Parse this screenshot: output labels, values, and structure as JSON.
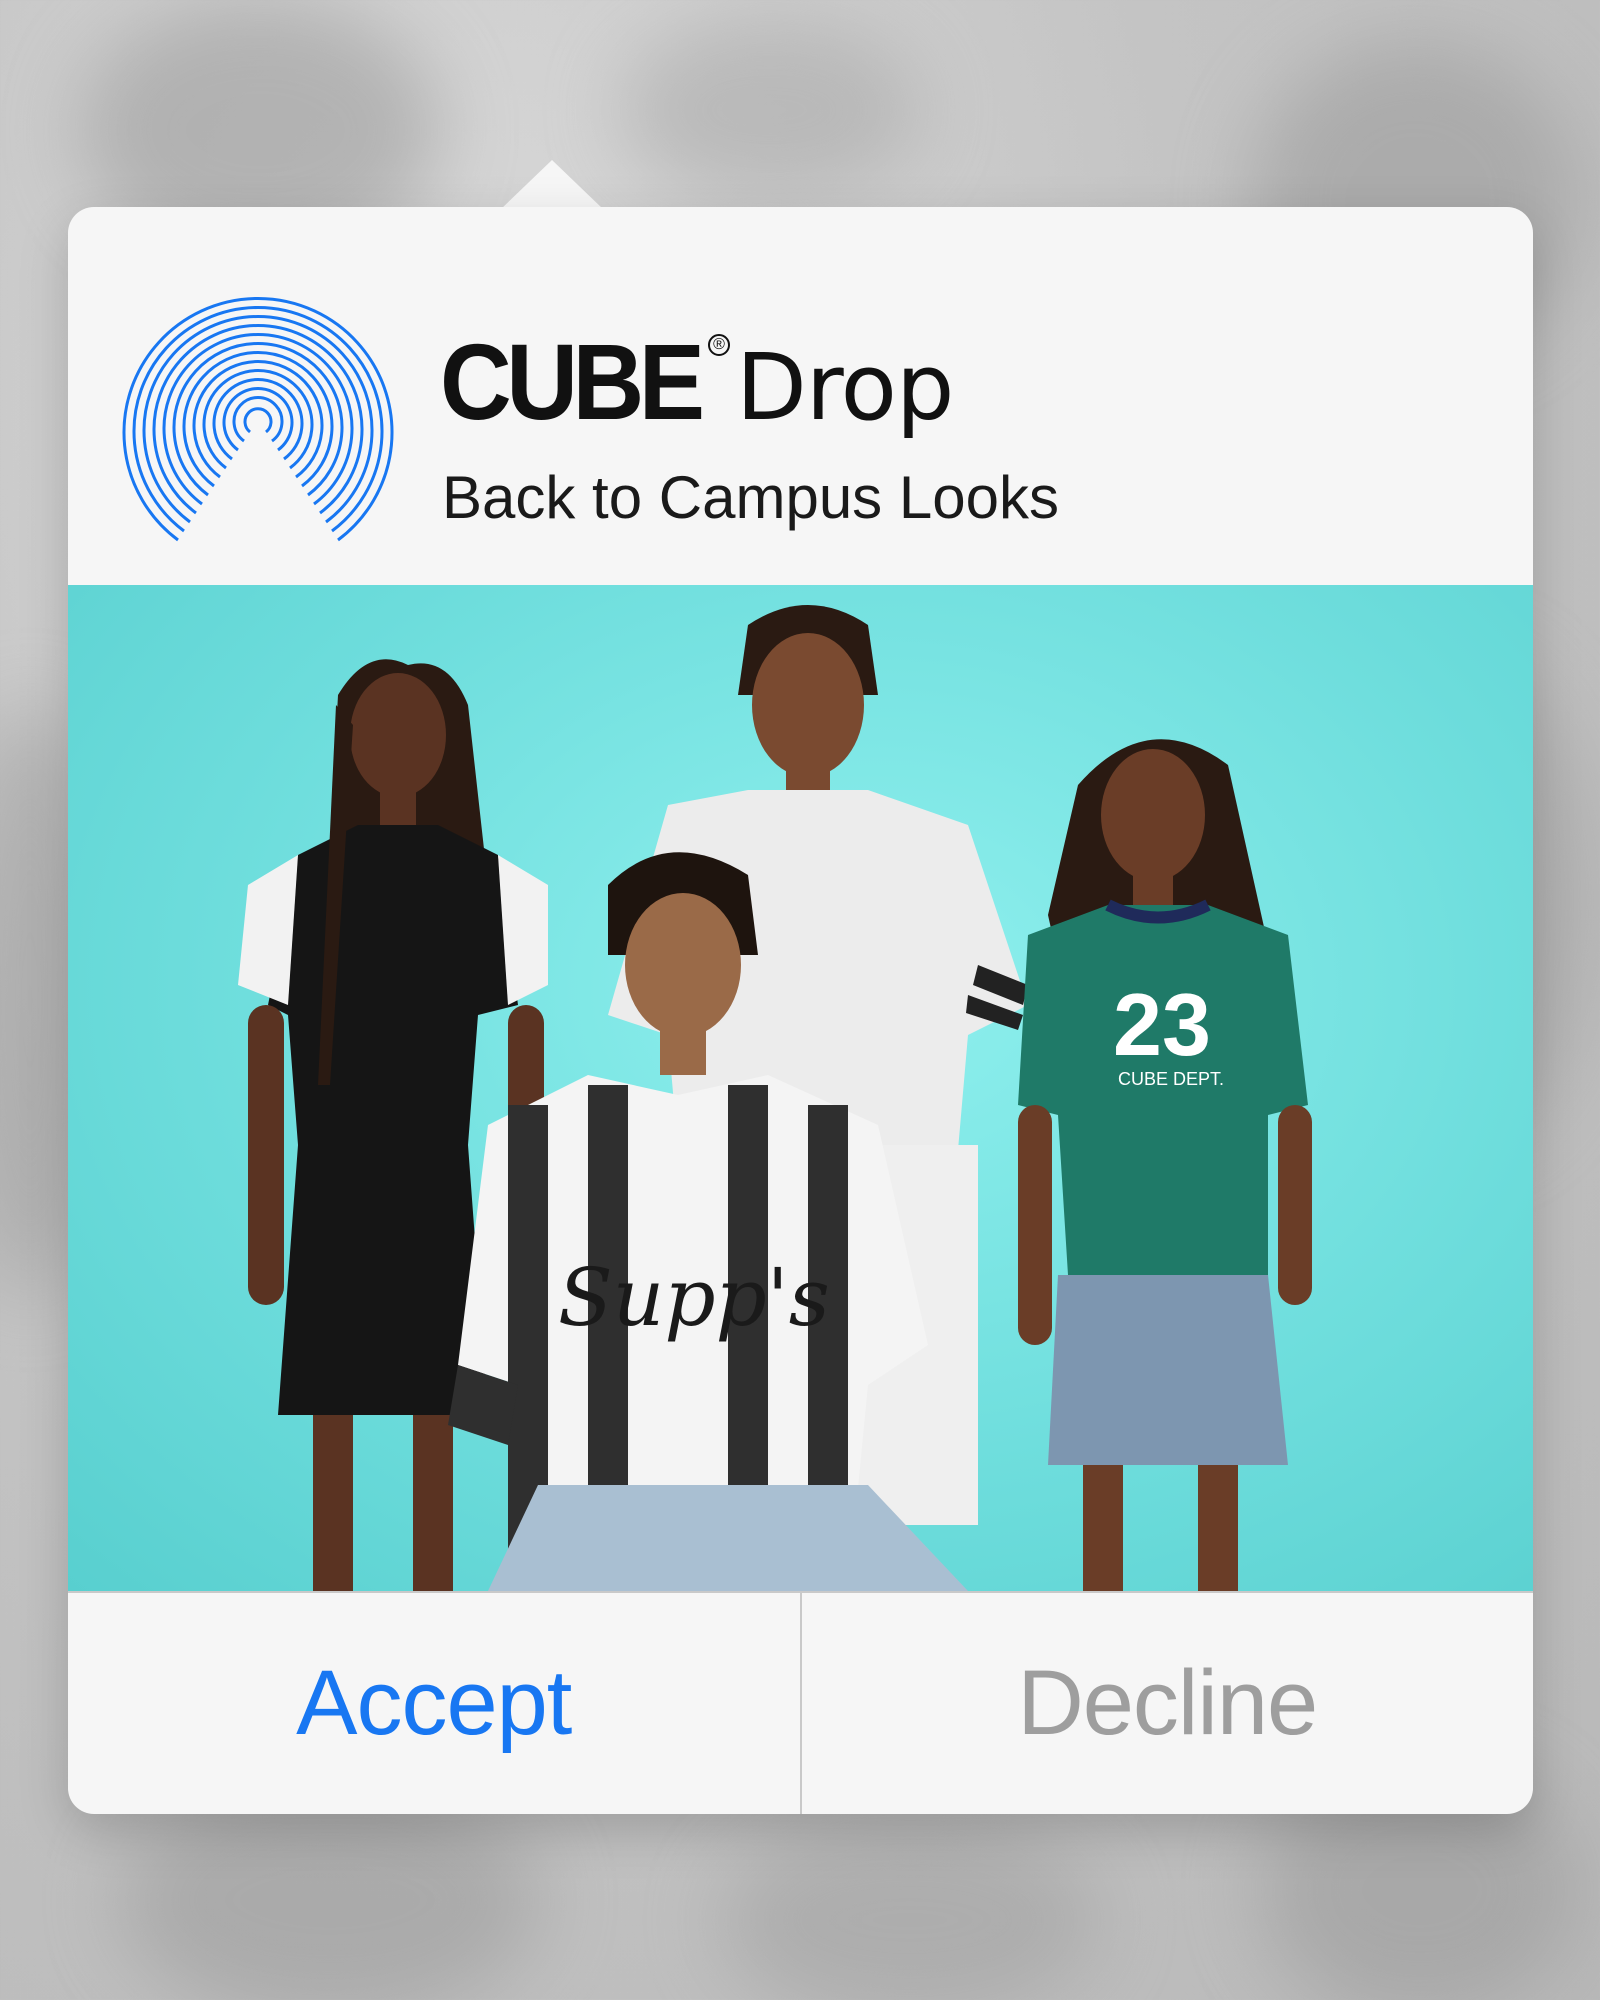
{
  "popover": {
    "brand": "CUBE",
    "brand_mark": "®",
    "title_suffix": "Drop",
    "subtitle": "Back to Campus Looks",
    "icon": "airdrop-icon",
    "accent_color": "#1877f2"
  },
  "photo": {
    "description_icon": "group-photo",
    "background_color": "#6fdedd"
  },
  "actions": {
    "accept_label": "Accept",
    "decline_label": "Decline",
    "accept_color": "#1877f2",
    "decline_color": "#9e9e9e"
  }
}
